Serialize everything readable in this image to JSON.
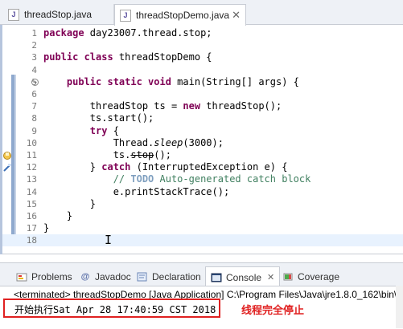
{
  "tabs": [
    {
      "label": "threadStop.java",
      "icon": "java-file-icon",
      "active": false
    },
    {
      "label": "threadStopDemo.java",
      "icon": "java-file-icon",
      "active": true,
      "close": "✕"
    }
  ],
  "java_badge": "J",
  "editor": {
    "line_numbers": [
      "1",
      "2",
      "3",
      "4",
      "5",
      "6",
      "7",
      "8",
      "9",
      "10",
      "11",
      "12",
      "13",
      "14",
      "15",
      "16",
      "17",
      "18"
    ],
    "lines": [
      {
        "t1": "package",
        "t2": " day23007.thread.stop;"
      },
      {},
      {
        "t1": "public class",
        "t2": " threadStopDemo {"
      },
      {},
      {
        "t0": "    ",
        "t1": "public static void",
        "t2": " main(String[] args) {"
      },
      {},
      {
        "t2": "        threadStop ts = ",
        "t1": "new",
        "t3": " threadStop();"
      },
      {
        "t2": "        ts.start();"
      },
      {
        "t0": "        ",
        "t1": "try",
        "t2": " {"
      },
      {
        "t2": "            Thread.",
        "it": "sleep",
        "t3": "(3000);"
      },
      {
        "t2": "            ts.",
        "strike": "stop",
        "t3": "();"
      },
      {
        "t0": "        } ",
        "t1": "catch",
        "t2": " (InterruptedException e) {"
      },
      {
        "c1": "            // ",
        "todo": "TODO",
        "c2": " Auto-generated catch block"
      },
      {
        "t2": "            e.printStackTrace();"
      },
      {
        "t2": "        }"
      },
      {
        "t2": "    }"
      },
      {
        "t2": "}"
      },
      {}
    ]
  },
  "panel": {
    "tabs": [
      {
        "label": "Problems",
        "icon": "problems-icon"
      },
      {
        "label": "Javadoc",
        "icon": "javadoc-icon"
      },
      {
        "label": "Declaration",
        "icon": "declaration-icon"
      },
      {
        "label": "Console",
        "icon": "console-icon",
        "active": true,
        "close": "✕"
      },
      {
        "label": "Coverage",
        "icon": "coverage-icon"
      }
    ],
    "terminated": "<terminated> threadStopDemo [Java Application] C:\\Program Files\\Java\\jre1.8.0_162\\bin\\",
    "output": "开始执行Sat Apr 28 17:40:59 CST 2018",
    "annotation": "线程完全停止"
  },
  "colors": {
    "keyword": "#7f0055",
    "comment": "#3f7f5f",
    "highlight_box": "#e02020"
  }
}
